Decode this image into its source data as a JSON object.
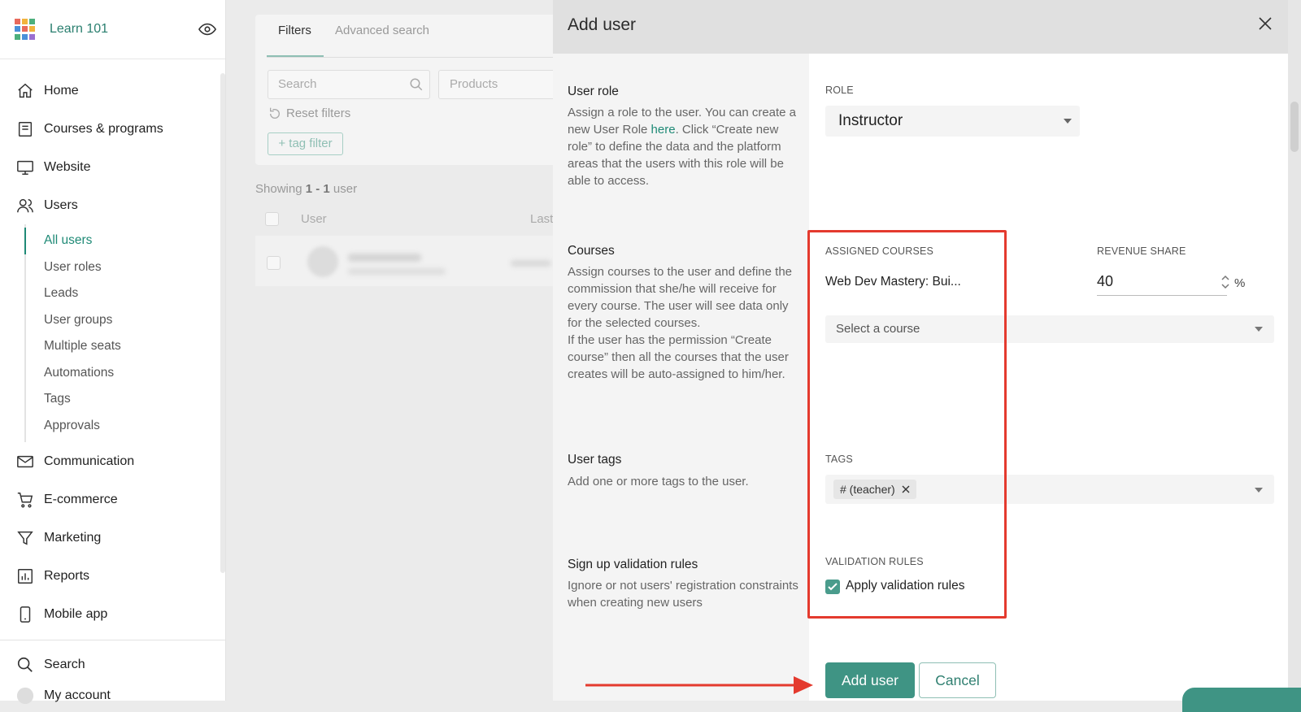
{
  "app": {
    "name": "Learn 101"
  },
  "sidebar": {
    "main_items": [
      {
        "label": "Home",
        "icon": "home-icon"
      },
      {
        "label": "Courses & programs",
        "icon": "book-icon"
      },
      {
        "label": "Website",
        "icon": "monitor-icon"
      },
      {
        "label": "Users",
        "icon": "users-icon"
      }
    ],
    "user_subitems": [
      {
        "label": "All users",
        "active": true
      },
      {
        "label": "User roles"
      },
      {
        "label": "Leads"
      },
      {
        "label": "User groups"
      },
      {
        "label": "Multiple seats"
      },
      {
        "label": "Automations"
      },
      {
        "label": "Tags"
      },
      {
        "label": "Approvals"
      }
    ],
    "more_items": [
      {
        "label": "Communication",
        "icon": "mail-icon"
      },
      {
        "label": "E-commerce",
        "icon": "cart-icon"
      },
      {
        "label": "Marketing",
        "icon": "funnel-icon"
      },
      {
        "label": "Reports",
        "icon": "chart-icon"
      },
      {
        "label": "Mobile app",
        "icon": "phone-icon"
      }
    ],
    "bottom_items": [
      {
        "label": "Search",
        "icon": "search-icon"
      },
      {
        "label": "My account",
        "icon": "avatar-icon"
      }
    ]
  },
  "list": {
    "tabs": [
      "Filters",
      "Advanced search"
    ],
    "search_placeholder": "Search",
    "products_placeholder": "Products",
    "reset_filters": "Reset filters",
    "tag_filter": "+ tag filter",
    "showing_prefix": "Showing ",
    "showing_range": "1 - 1",
    "showing_suffix": " user",
    "col_user": "User",
    "col_last": "Last"
  },
  "modal": {
    "title": "Add user",
    "user_role": {
      "title": "User role",
      "desc_before": "Assign a role to the user. You can create a new User Role ",
      "desc_link": "here",
      "desc_after": ". Click “Create new role” to define the data and the platform areas that the users with this role will be able to access.",
      "field_label": "ROLE",
      "value": "Instructor"
    },
    "courses": {
      "title": "Courses",
      "desc": "Assign courses to the user and define the commission that she/he will receive for every course. The user will see data only for the selected courses.\nIf the user has the permission “Create course” then all the courses that the user creates will be auto-assigned to him/her.",
      "assigned_label": "ASSIGNED COURSES",
      "revenue_label": "REVENUE SHARE",
      "course_name": "Web Dev Mastery: Bui...",
      "revenue_value": "40",
      "percent": "%",
      "select_placeholder": "Select a course"
    },
    "tags": {
      "title": "User tags",
      "desc": "Add one or more tags to the user.",
      "field_label": "TAGS",
      "chips": [
        "# (teacher)"
      ]
    },
    "validation": {
      "title": "Sign up validation rules",
      "desc": "Ignore or not users' registration constraints when creating new users",
      "field_label": "VALIDATION RULES",
      "checkbox_label": "Apply validation rules",
      "checked": true
    },
    "buttons": {
      "add": "Add user",
      "cancel": "Cancel"
    }
  },
  "colors": {
    "accent": "#3f9484",
    "highlight_red": "#e43a2e",
    "link": "#1f8a76"
  }
}
